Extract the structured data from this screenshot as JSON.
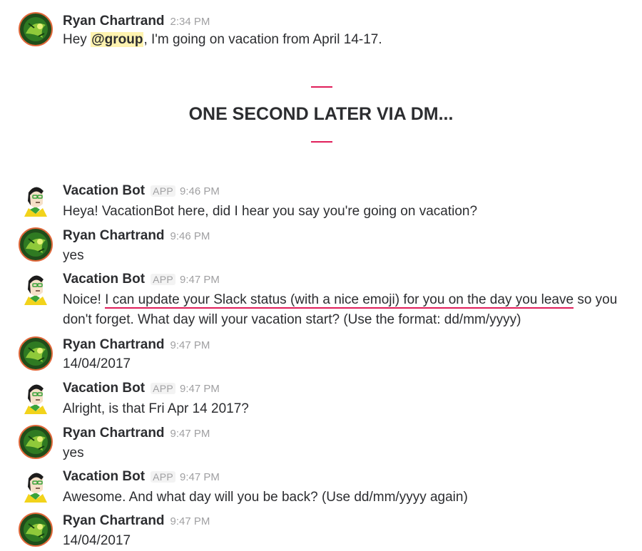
{
  "intro": {
    "sender": "Ryan Chartrand",
    "time": "2:34 PM",
    "text_before": "Hey ",
    "mention": "@group",
    "text_after": ", I'm going on vacation from April 14-17."
  },
  "divider": {
    "heading": "ONE SECOND LATER VIA DM..."
  },
  "app_tag": "APP",
  "messages": [
    {
      "sender": "Vacation Bot",
      "is_app": true,
      "time": "9:46 PM",
      "text": "Heya! VacationBot here, did I hear you say you're going on vacation?"
    },
    {
      "sender": "Ryan Chartrand",
      "is_app": false,
      "time": "9:46 PM",
      "text": "yes"
    },
    {
      "sender": "Vacation Bot",
      "is_app": true,
      "time": "9:47 PM",
      "text_before": "Noice! ",
      "text_highlight": "I can update your Slack status (with a nice emoji) for you on the day you leave",
      "text_after": " so you don't forget. What day will your vacation start? (Use the format: dd/mm/yyyy)"
    },
    {
      "sender": "Ryan Chartrand",
      "is_app": false,
      "time": "9:47 PM",
      "text": "14/04/2017"
    },
    {
      "sender": "Vacation Bot",
      "is_app": true,
      "time": "9:47 PM",
      "text": "Alright, is that Fri Apr 14 2017?"
    },
    {
      "sender": "Ryan Chartrand",
      "is_app": false,
      "time": "9:47 PM",
      "text": "yes"
    },
    {
      "sender": "Vacation Bot",
      "is_app": true,
      "time": "9:47 PM",
      "text": "Awesome. And what day will you be back? (Use dd/mm/yyyy again)"
    },
    {
      "sender": "Ryan Chartrand",
      "is_app": false,
      "time": "9:47 PM",
      "text": "14/04/2017"
    }
  ],
  "colors": {
    "accent": "#e01e5a",
    "mention_bg": "#fff3b0",
    "timestamp": "#a0a0a2"
  }
}
